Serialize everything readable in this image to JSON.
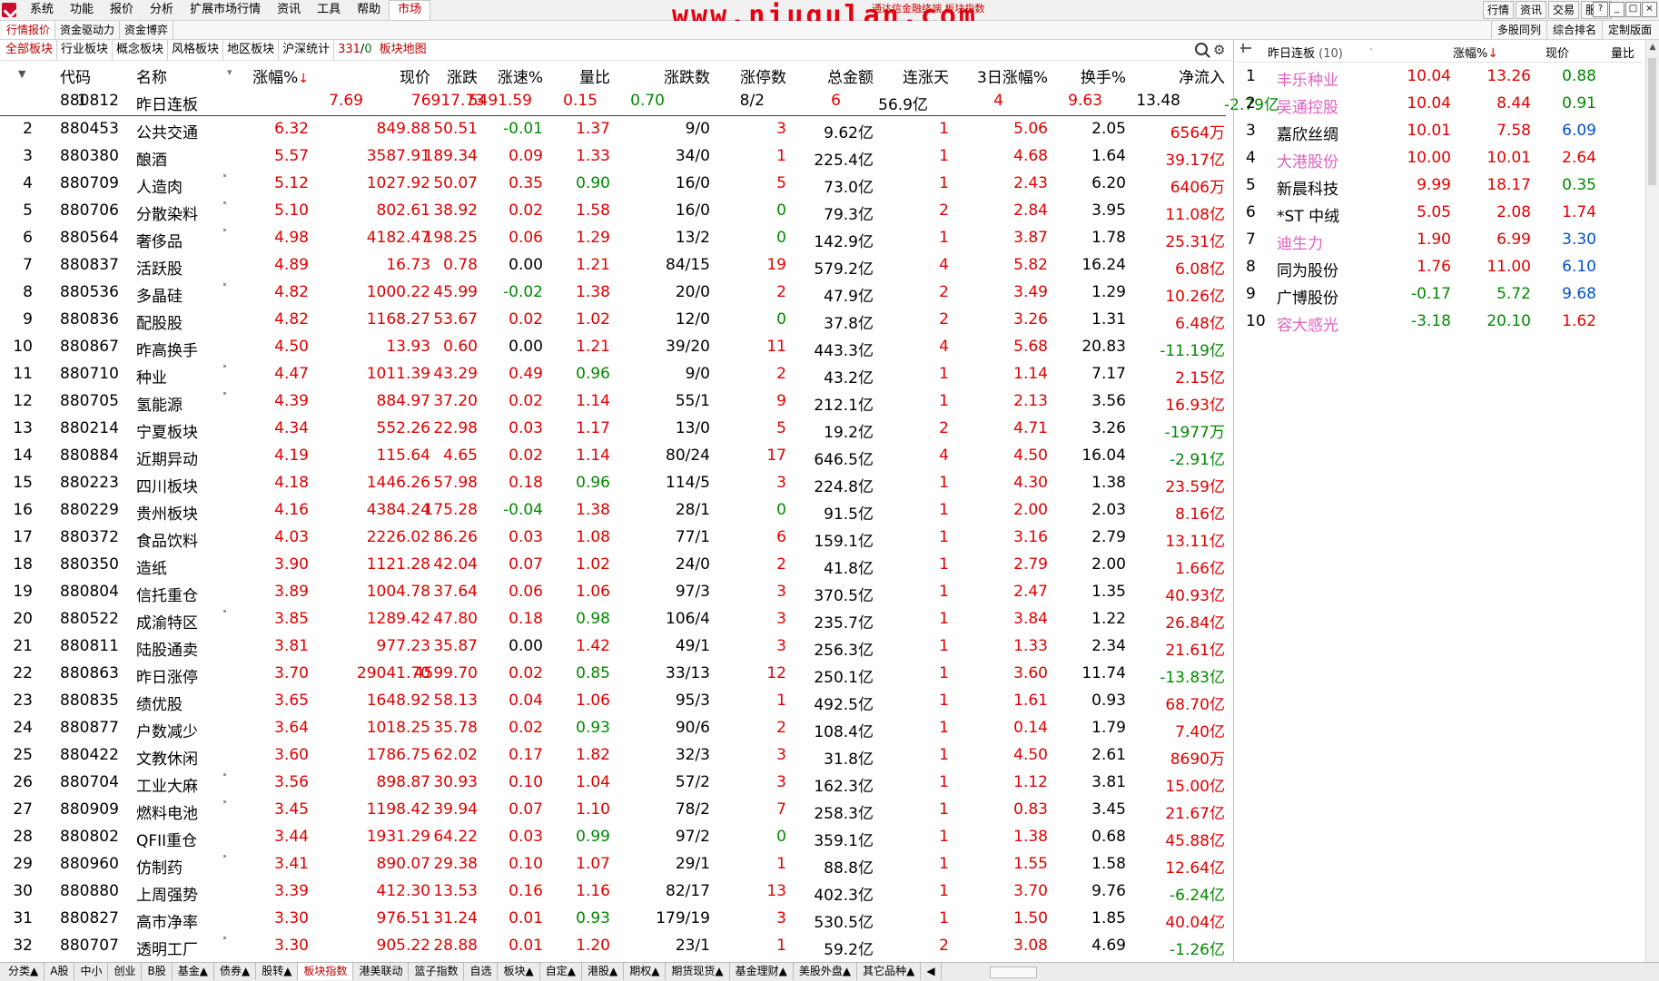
{
  "menubar": {
    "items": [
      "系统",
      "功能",
      "报价",
      "分析",
      "扩展市场行情",
      "资讯",
      "工具",
      "帮助",
      "市场"
    ],
    "right_buttons": [
      "行情",
      "资讯",
      "交易",
      "服务"
    ],
    "window_controls": [
      "?",
      "_",
      "□",
      "×"
    ]
  },
  "watermark": "www.niugulan.com",
  "watermark_sub": "通达信金融终端  板块指数",
  "subbar": {
    "left": [
      "行情报价",
      "资金驱动力",
      "资金博弈"
    ],
    "right": [
      "多股同列",
      "综合排名",
      "定制版面"
    ]
  },
  "boardtabs": {
    "tabs": [
      "全部板块",
      "行业板块",
      "概念板块",
      "风格板块",
      "地区板块",
      "沪深统计"
    ],
    "count": "331",
    "count_sep": "/",
    "count_zero": "0",
    "map": "板块地图"
  },
  "table": {
    "headers": [
      "代码",
      "名称",
      "涨幅%",
      "现价",
      "涨跌",
      "涨速%",
      "量比",
      "涨跌数",
      "涨停数",
      "总金额",
      "连涨天",
      "3日涨幅%",
      "换手%",
      "净流入"
    ],
    "sort_arrow": "↓",
    "rows": [
      {
        "idx": "1",
        "code": "880812",
        "name": "昨日连板",
        "chg": "7.69",
        "price": "76917.73",
        "diff": "5491.59",
        "speed": "0.15",
        "vr": "0.70",
        "ud": "8/2",
        "lim": "6",
        "amt": "56.9亿",
        "days": "4",
        "chg3": "9.63",
        "turn": "13.48",
        "flow": "-2.79亿",
        "dot": false
      },
      {
        "idx": "2",
        "code": "880453",
        "name": "公共交通",
        "chg": "6.32",
        "price": "849.88",
        "diff": "50.51",
        "speed": "-0.01",
        "vr": "1.37",
        "ud": "9/0",
        "lim": "3",
        "amt": "9.62亿",
        "days": "1",
        "chg3": "5.06",
        "turn": "2.05",
        "flow": "6564万",
        "dot": false
      },
      {
        "idx": "3",
        "code": "880380",
        "name": "酿酒",
        "chg": "5.57",
        "price": "3587.91",
        "diff": "189.34",
        "speed": "0.09",
        "vr": "1.33",
        "ud": "34/0",
        "lim": "1",
        "amt": "225.4亿",
        "days": "1",
        "chg3": "4.68",
        "turn": "1.64",
        "flow": "39.17亿",
        "dot": false
      },
      {
        "idx": "4",
        "code": "880709",
        "name": "人造肉",
        "chg": "5.12",
        "price": "1027.92",
        "diff": "50.07",
        "speed": "0.35",
        "vr": "0.90",
        "ud": "16/0",
        "lim": "5",
        "amt": "73.0亿",
        "days": "1",
        "chg3": "2.43",
        "turn": "6.20",
        "flow": "6406万",
        "dot": true
      },
      {
        "idx": "5",
        "code": "880706",
        "name": "分散染料",
        "chg": "5.10",
        "price": "802.61",
        "diff": "38.92",
        "speed": "0.02",
        "vr": "1.58",
        "ud": "16/0",
        "lim": "0",
        "amt": "79.3亿",
        "days": "2",
        "chg3": "2.84",
        "turn": "3.95",
        "flow": "11.08亿",
        "dot": true
      },
      {
        "idx": "6",
        "code": "880564",
        "name": "奢侈品",
        "chg": "4.98",
        "price": "4182.47",
        "diff": "198.25",
        "speed": "0.06",
        "vr": "1.29",
        "ud": "13/2",
        "lim": "0",
        "amt": "142.9亿",
        "days": "1",
        "chg3": "3.87",
        "turn": "1.78",
        "flow": "25.31亿",
        "dot": true
      },
      {
        "idx": "7",
        "code": "880837",
        "name": "活跃股",
        "chg": "4.89",
        "price": "16.73",
        "diff": "0.78",
        "speed": "0.00",
        "vr": "1.21",
        "ud": "84/15",
        "lim": "19",
        "amt": "579.2亿",
        "days": "4",
        "chg3": "5.82",
        "turn": "16.24",
        "flow": "6.08亿",
        "dot": false
      },
      {
        "idx": "8",
        "code": "880536",
        "name": "多晶硅",
        "chg": "4.82",
        "price": "1000.22",
        "diff": "45.99",
        "speed": "-0.02",
        "vr": "1.38",
        "ud": "20/0",
        "lim": "2",
        "amt": "47.9亿",
        "days": "2",
        "chg3": "3.49",
        "turn": "1.29",
        "flow": "10.26亿",
        "dot": true
      },
      {
        "idx": "9",
        "code": "880836",
        "name": "配股股",
        "chg": "4.82",
        "price": "1168.27",
        "diff": "53.67",
        "speed": "0.02",
        "vr": "1.02",
        "ud": "12/0",
        "lim": "0",
        "amt": "37.8亿",
        "days": "2",
        "chg3": "3.26",
        "turn": "1.31",
        "flow": "6.48亿",
        "dot": false
      },
      {
        "idx": "10",
        "code": "880867",
        "name": "昨高换手",
        "chg": "4.50",
        "price": "13.93",
        "diff": "0.60",
        "speed": "0.00",
        "vr": "1.21",
        "ud": "39/20",
        "lim": "11",
        "amt": "443.3亿",
        "days": "4",
        "chg3": "5.68",
        "turn": "20.83",
        "flow": "-11.19亿",
        "dot": false
      },
      {
        "idx": "11",
        "code": "880710",
        "name": "种业",
        "chg": "4.47",
        "price": "1011.39",
        "diff": "43.29",
        "speed": "0.49",
        "vr": "0.96",
        "ud": "9/0",
        "lim": "2",
        "amt": "43.2亿",
        "days": "1",
        "chg3": "1.14",
        "turn": "7.17",
        "flow": "2.15亿",
        "dot": true
      },
      {
        "idx": "12",
        "code": "880705",
        "name": "氢能源",
        "chg": "4.39",
        "price": "884.97",
        "diff": "37.20",
        "speed": "0.02",
        "vr": "1.14",
        "ud": "55/1",
        "lim": "9",
        "amt": "212.1亿",
        "days": "1",
        "chg3": "2.13",
        "turn": "3.56",
        "flow": "16.93亿",
        "dot": true
      },
      {
        "idx": "13",
        "code": "880214",
        "name": "宁夏板块",
        "chg": "4.34",
        "price": "552.26",
        "diff": "22.98",
        "speed": "0.03",
        "vr": "1.17",
        "ud": "13/0",
        "lim": "5",
        "amt": "19.2亿",
        "days": "2",
        "chg3": "4.71",
        "turn": "3.26",
        "flow": "-1977万",
        "dot": false
      },
      {
        "idx": "14",
        "code": "880884",
        "name": "近期异动",
        "chg": "4.19",
        "price": "115.64",
        "diff": "4.65",
        "speed": "0.02",
        "vr": "1.14",
        "ud": "80/24",
        "lim": "17",
        "amt": "646.5亿",
        "days": "4",
        "chg3": "4.50",
        "turn": "16.04",
        "flow": "-2.91亿",
        "dot": false
      },
      {
        "idx": "15",
        "code": "880223",
        "name": "四川板块",
        "chg": "4.18",
        "price": "1446.26",
        "diff": "57.98",
        "speed": "0.18",
        "vr": "0.96",
        "ud": "114/5",
        "lim": "3",
        "amt": "224.8亿",
        "days": "1",
        "chg3": "4.30",
        "turn": "1.38",
        "flow": "23.59亿",
        "dot": false
      },
      {
        "idx": "16",
        "code": "880229",
        "name": "贵州板块",
        "chg": "4.16",
        "price": "4384.24",
        "diff": "175.28",
        "speed": "-0.04",
        "vr": "1.38",
        "ud": "28/1",
        "lim": "0",
        "amt": "91.5亿",
        "days": "1",
        "chg3": "2.00",
        "turn": "2.03",
        "flow": "8.16亿",
        "dot": false
      },
      {
        "idx": "17",
        "code": "880372",
        "name": "食品饮料",
        "chg": "4.03",
        "price": "2226.02",
        "diff": "86.26",
        "speed": "0.03",
        "vr": "1.08",
        "ud": "77/1",
        "lim": "6",
        "amt": "159.1亿",
        "days": "1",
        "chg3": "3.16",
        "turn": "2.79",
        "flow": "13.11亿",
        "dot": false
      },
      {
        "idx": "18",
        "code": "880350",
        "name": "造纸",
        "chg": "3.90",
        "price": "1121.28",
        "diff": "42.04",
        "speed": "0.07",
        "vr": "1.02",
        "ud": "24/0",
        "lim": "2",
        "amt": "41.8亿",
        "days": "1",
        "chg3": "2.79",
        "turn": "2.00",
        "flow": "1.66亿",
        "dot": false
      },
      {
        "idx": "19",
        "code": "880804",
        "name": "信托重仓",
        "chg": "3.89",
        "price": "1004.78",
        "diff": "37.64",
        "speed": "0.06",
        "vr": "1.06",
        "ud": "97/3",
        "lim": "3",
        "amt": "370.5亿",
        "days": "1",
        "chg3": "2.47",
        "turn": "1.35",
        "flow": "40.93亿",
        "dot": false
      },
      {
        "idx": "20",
        "code": "880522",
        "name": "成渝特区",
        "chg": "3.85",
        "price": "1289.42",
        "diff": "47.80",
        "speed": "0.18",
        "vr": "0.98",
        "ud": "106/4",
        "lim": "3",
        "amt": "235.7亿",
        "days": "1",
        "chg3": "3.84",
        "turn": "1.22",
        "flow": "26.84亿",
        "dot": true
      },
      {
        "idx": "21",
        "code": "880811",
        "name": "陆股通卖",
        "chg": "3.81",
        "price": "977.23",
        "diff": "35.87",
        "speed": "0.00",
        "vr": "1.42",
        "ud": "49/1",
        "lim": "3",
        "amt": "256.3亿",
        "days": "1",
        "chg3": "1.33",
        "turn": "2.34",
        "flow": "21.61亿",
        "dot": false
      },
      {
        "idx": "22",
        "code": "880863",
        "name": "昨日涨停",
        "chg": "3.70",
        "price": "29041.70",
        "diff": "4599.70",
        "speed": "0.02",
        "vr": "0.85",
        "ud": "33/13",
        "lim": "12",
        "amt": "250.1亿",
        "days": "1",
        "chg3": "3.60",
        "turn": "11.74",
        "flow": "-13.83亿",
        "dot": false
      },
      {
        "idx": "23",
        "code": "880835",
        "name": "绩优股",
        "chg": "3.65",
        "price": "1648.92",
        "diff": "58.13",
        "speed": "0.04",
        "vr": "1.06",
        "ud": "95/3",
        "lim": "1",
        "amt": "492.5亿",
        "days": "1",
        "chg3": "1.61",
        "turn": "0.93",
        "flow": "68.70亿",
        "dot": false
      },
      {
        "idx": "24",
        "code": "880877",
        "name": "户数减少",
        "chg": "3.64",
        "price": "1018.25",
        "diff": "35.78",
        "speed": "0.02",
        "vr": "0.93",
        "ud": "90/6",
        "lim": "2",
        "amt": "108.4亿",
        "days": "1",
        "chg3": "0.14",
        "turn": "1.79",
        "flow": "7.40亿",
        "dot": false
      },
      {
        "idx": "25",
        "code": "880422",
        "name": "文教休闲",
        "chg": "3.60",
        "price": "1786.75",
        "diff": "62.02",
        "speed": "0.17",
        "vr": "1.82",
        "ud": "32/3",
        "lim": "3",
        "amt": "31.8亿",
        "days": "1",
        "chg3": "4.50",
        "turn": "2.61",
        "flow": "8690万",
        "dot": false
      },
      {
        "idx": "26",
        "code": "880704",
        "name": "工业大麻",
        "chg": "3.56",
        "price": "898.87",
        "diff": "30.93",
        "speed": "0.10",
        "vr": "1.04",
        "ud": "57/2",
        "lim": "3",
        "amt": "162.3亿",
        "days": "1",
        "chg3": "1.12",
        "turn": "3.81",
        "flow": "15.00亿",
        "dot": true
      },
      {
        "idx": "27",
        "code": "880909",
        "name": "燃料电池",
        "chg": "3.45",
        "price": "1198.42",
        "diff": "39.94",
        "speed": "0.07",
        "vr": "1.10",
        "ud": "78/2",
        "lim": "7",
        "amt": "258.3亿",
        "days": "1",
        "chg3": "0.83",
        "turn": "3.45",
        "flow": "21.67亿",
        "dot": true
      },
      {
        "idx": "28",
        "code": "880802",
        "name": "QFII重仓",
        "chg": "3.44",
        "price": "1931.29",
        "diff": "64.22",
        "speed": "0.03",
        "vr": "0.99",
        "ud": "97/2",
        "lim": "0",
        "amt": "359.1亿",
        "days": "1",
        "chg3": "1.38",
        "turn": "0.68",
        "flow": "45.88亿",
        "dot": false
      },
      {
        "idx": "29",
        "code": "880960",
        "name": "仿制药",
        "chg": "3.41",
        "price": "890.07",
        "diff": "29.38",
        "speed": "0.10",
        "vr": "1.07",
        "ud": "29/1",
        "lim": "1",
        "amt": "88.8亿",
        "days": "1",
        "chg3": "1.55",
        "turn": "1.58",
        "flow": "12.64亿",
        "dot": true
      },
      {
        "idx": "30",
        "code": "880880",
        "name": "上周强势",
        "chg": "3.39",
        "price": "412.30",
        "diff": "13.53",
        "speed": "0.16",
        "vr": "1.16",
        "ud": "82/17",
        "lim": "13",
        "amt": "402.3亿",
        "days": "1",
        "chg3": "3.70",
        "turn": "9.76",
        "flow": "-6.24亿",
        "dot": false
      },
      {
        "idx": "31",
        "code": "880827",
        "name": "高市净率",
        "chg": "3.30",
        "price": "976.51",
        "diff": "31.24",
        "speed": "0.01",
        "vr": "0.93",
        "ud": "179/19",
        "lim": "3",
        "amt": "530.5亿",
        "days": "1",
        "chg3": "1.50",
        "turn": "1.85",
        "flow": "40.04亿",
        "dot": false
      },
      {
        "idx": "32",
        "code": "880707",
        "name": "透明工厂",
        "chg": "3.30",
        "price": "905.22",
        "diff": "28.88",
        "speed": "0.01",
        "vr": "1.20",
        "ud": "23/1",
        "lim": "1",
        "amt": "59.2亿",
        "days": "2",
        "chg3": "3.08",
        "turn": "4.69",
        "flow": "-1.26亿",
        "dot": true
      }
    ]
  },
  "right_panel": {
    "title": "昨日连板",
    "title_count": "(10)",
    "headers": [
      "涨幅%",
      "现价",
      "量比"
    ],
    "sort_arrow": "↓",
    "rows": [
      {
        "idx": "1",
        "name": "丰乐种业",
        "chg": "10.04",
        "price": "13.26",
        "vr": "0.88",
        "name_color": "pink"
      },
      {
        "idx": "2",
        "name": "吴通控股",
        "chg": "10.04",
        "price": "8.44",
        "vr": "0.91",
        "name_color": "pink"
      },
      {
        "idx": "3",
        "name": "嘉欣丝绸",
        "chg": "10.01",
        "price": "7.58",
        "vr": "6.09",
        "name_color": "black"
      },
      {
        "idx": "4",
        "name": "大港股份",
        "chg": "10.00",
        "price": "10.01",
        "vr": "2.64",
        "name_color": "pink"
      },
      {
        "idx": "5",
        "name": "新晨科技",
        "chg": "9.99",
        "price": "18.17",
        "vr": "0.35",
        "name_color": "black"
      },
      {
        "idx": "6",
        "name": "*ST 中绒",
        "chg": "5.05",
        "price": "2.08",
        "vr": "1.74",
        "name_color": "black"
      },
      {
        "idx": "7",
        "name": "迪生力",
        "chg": "1.90",
        "price": "6.99",
        "vr": "3.30",
        "name_color": "pink"
      },
      {
        "idx": "8",
        "name": "同为股份",
        "chg": "1.76",
        "price": "11.00",
        "vr": "6.10",
        "name_color": "black"
      },
      {
        "idx": "9",
        "name": "广博股份",
        "chg": "-0.17",
        "price": "5.72",
        "vr": "9.68",
        "name_color": "black"
      },
      {
        "idx": "10",
        "name": "容大感光",
        "chg": "-3.18",
        "price": "20.10",
        "vr": "1.62",
        "name_color": "pink"
      }
    ]
  },
  "bottom_tabs": [
    "分类▲",
    "A股",
    "中小",
    "创业",
    "B股",
    "基金▲",
    "债券▲",
    "股转▲",
    "板块指数",
    "港美联动",
    "篮子指数",
    "自选",
    "板块▲",
    "自定▲",
    "港股▲",
    "期权▲",
    "期货现货▲",
    "基金理财▲",
    "美股外盘▲",
    "其它品种▲",
    "◀"
  ],
  "bottom_active": "板块指数",
  "colors": {
    "up": "#e00000",
    "down": "#008a00",
    "flat": "#000000",
    "accent": "#c00000"
  }
}
